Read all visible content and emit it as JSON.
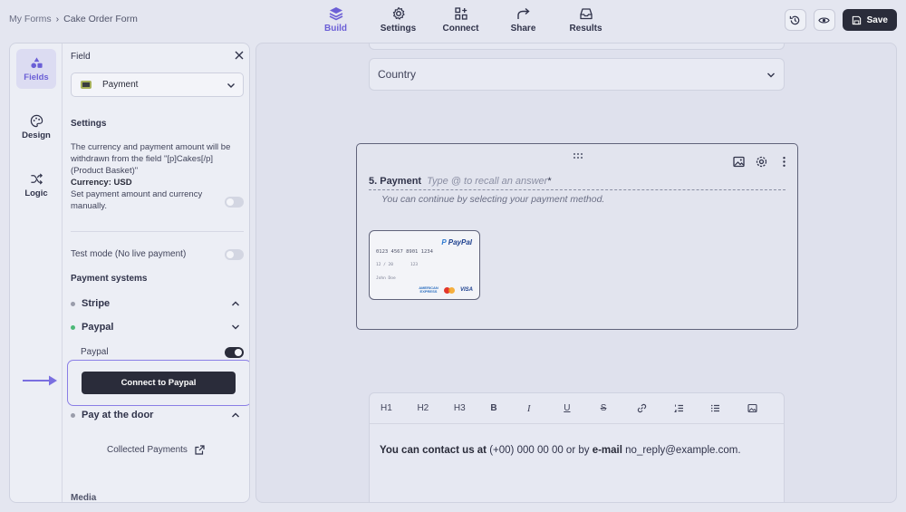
{
  "breadcrumb": {
    "root": "My Forms",
    "separator": "›",
    "current": "Cake Order Form"
  },
  "nav_tabs": [
    {
      "label": "Build",
      "icon": "layers-icon",
      "active": true
    },
    {
      "label": "Settings",
      "icon": "gear-icon",
      "active": false
    },
    {
      "label": "Connect",
      "icon": "connect-icon",
      "active": false
    },
    {
      "label": "Share",
      "icon": "share-arrow-icon",
      "active": false
    },
    {
      "label": "Results",
      "icon": "inbox-icon",
      "active": false
    }
  ],
  "toolbar": {
    "history_icon": "history-icon",
    "preview_icon": "eye-icon",
    "save_label": "Save"
  },
  "rail": [
    {
      "label": "Fields",
      "icon": "shapes-icon",
      "active": true
    },
    {
      "label": "Design",
      "icon": "palette-icon",
      "active": false
    },
    {
      "label": "Logic",
      "icon": "shuffle-icon",
      "active": false
    }
  ],
  "field_panel": {
    "header": "Field",
    "selected_field": "Payment",
    "settings_title": "Settings",
    "description": "The currency and payment amount will be withdrawn from the field \"[p]Cakes[/p] (Product Basket)\"",
    "currency_label": "Currency: USD",
    "manual_label": "Set payment amount and currency manually.",
    "manual_enabled": false,
    "test_mode_label": "Test mode (No live payment)",
    "test_mode_enabled": false,
    "payment_systems_title": "Payment systems",
    "systems": [
      {
        "name": "Stripe",
        "status": "gray",
        "expanded": true
      },
      {
        "name": "Paypal",
        "status": "green",
        "expanded": false
      },
      {
        "name": "Pay at the door",
        "status": "gray",
        "expanded": true
      }
    ],
    "paypal_toggle_label": "Paypal",
    "paypal_enabled": true,
    "connect_button": "Connect to Paypal",
    "collected_payments": "Collected Payments",
    "media_title": "Media"
  },
  "canvas": {
    "country_placeholder": "Country",
    "question": {
      "number": "5. Payment",
      "placeholder": "Type @ to recall an answer",
      "required_mark": "*",
      "description": "You can continue by selecting your payment method."
    },
    "card": {
      "brand": "PayPal",
      "number": "0123 4567 8901 1234",
      "expiry": "12 / 20",
      "cvc": "123",
      "name": "John Doe",
      "logo_amex": "AMERICAN EXPRESS",
      "logo_visa": "VISA"
    },
    "editor": {
      "tools": [
        "H1",
        "H2",
        "H3",
        "B",
        "I",
        "U",
        "S"
      ],
      "tool_icons": [
        "link-icon",
        "ordered-list-icon",
        "bullet-list-icon",
        "image-icon"
      ],
      "text_bold_1": "You can contact us at",
      "text_1": " (+00) 000 00 00 or by ",
      "text_bold_2": "e-mail",
      "text_2": " no_reply@example.com."
    }
  },
  "colors": {
    "accent": "#6b5fd6",
    "dark": "#2a2c3a",
    "green": "#4cb877"
  }
}
